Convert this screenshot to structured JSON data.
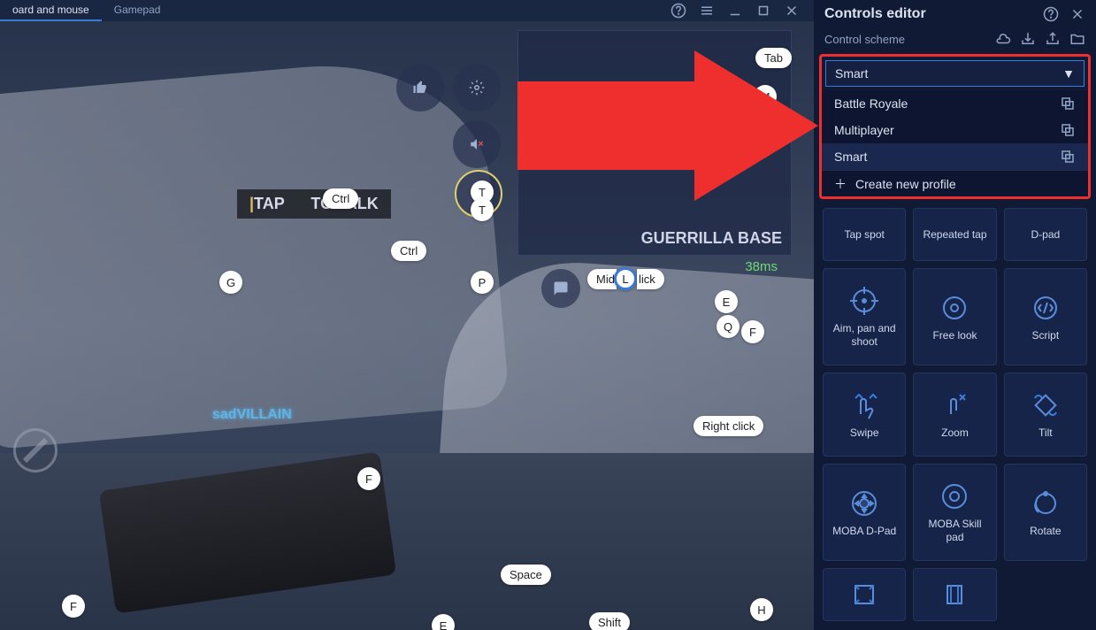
{
  "top_bar": {
    "tabs": [
      "oard and mouse",
      "Gamepad"
    ],
    "active_tab": 0
  },
  "game": {
    "tap_to_talk_pre": "TAP ",
    "tap_to_talk_post": " TO TALK",
    "minimap_label": "GUERRILLA BASE",
    "ping": "38ms",
    "player_name": "sadVILLAIN"
  },
  "keys": {
    "tab": "Tab",
    "m": "M",
    "ctrl1": "Ctrl",
    "ctrl2": "Ctrl",
    "t1": "T",
    "t2": "T",
    "g": "G",
    "p": "P",
    "mid": "Mid",
    "l": "L",
    "lick": "lick",
    "e": "E",
    "q": "Q",
    "f1": "F",
    "f2": "F",
    "f3": "F",
    "e2": "E",
    "right_click": "Right click",
    "space": "Space",
    "shift": "Shift",
    "h": "H"
  },
  "panel": {
    "title": "Controls editor",
    "scheme_label": "Control scheme",
    "dropdown_selected": "Smart",
    "options": [
      {
        "label": "Battle Royale"
      },
      {
        "label": "Multiplayer"
      },
      {
        "label": "Smart",
        "selected": true
      }
    ],
    "create_new": "Create new profile",
    "controls": [
      {
        "label": "Tap spot",
        "icon": "tap"
      },
      {
        "label": "Repeated tap",
        "icon": "repeat"
      },
      {
        "label": "D-pad",
        "icon": "dpad"
      },
      {
        "label": "Aim, pan and shoot",
        "icon": "aim"
      },
      {
        "label": "Free look",
        "icon": "freelook"
      },
      {
        "label": "Script",
        "icon": "script"
      },
      {
        "label": "Swipe",
        "icon": "swipe"
      },
      {
        "label": "Zoom",
        "icon": "zoom"
      },
      {
        "label": "Tilt",
        "icon": "tilt"
      },
      {
        "label": "MOBA D-Pad",
        "icon": "moba-dpad"
      },
      {
        "label": "MOBA Skill pad",
        "icon": "moba-skill"
      },
      {
        "label": "Rotate",
        "icon": "rotate"
      }
    ]
  }
}
